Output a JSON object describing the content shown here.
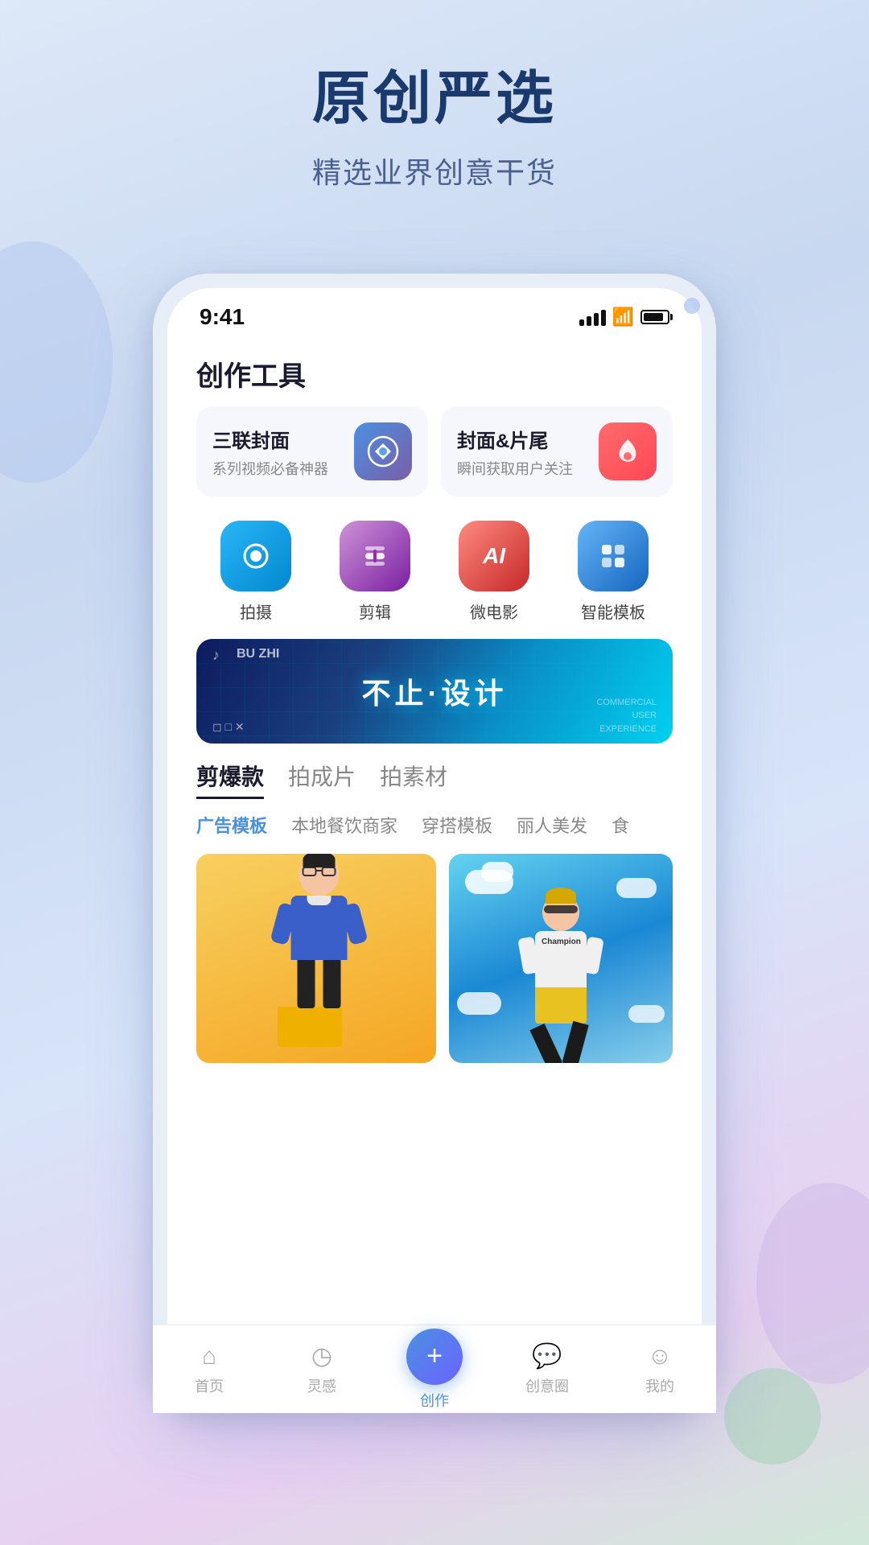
{
  "page": {
    "background": "light blue gradient"
  },
  "hero": {
    "title": "原创严选",
    "subtitle": "精选业界创意干货"
  },
  "phone": {
    "status_bar": {
      "time": "9:41",
      "signal_bars": 4,
      "wifi": true,
      "battery": 85
    },
    "page_title": "创作工具",
    "tool_cards": [
      {
        "id": "triple-cover",
        "title": "三联封面",
        "desc": "系列视频必备神器",
        "icon_type": "blue",
        "icon_symbol": "⭐"
      },
      {
        "id": "cover-tail",
        "title": "封面&片尾",
        "desc": "瞬间获取用户关注",
        "icon_type": "red",
        "icon_symbol": "🔥"
      }
    ],
    "icon_grid": [
      {
        "id": "shoot",
        "label": "拍摄",
        "color": "#4fc3f7",
        "bg": "linear-gradient(135deg, #29b6f6, #0288d1)",
        "symbol": "📷"
      },
      {
        "id": "edit",
        "label": "剪辑",
        "color": "#ab47bc",
        "bg": "linear-gradient(135deg, #ce93d8, #7b1fa2)",
        "symbol": "✂️"
      },
      {
        "id": "micro-film",
        "label": "微电影",
        "color": "#ef5350",
        "bg": "linear-gradient(135deg, #ef9a9a, #c62828)",
        "symbol": "AI"
      },
      {
        "id": "smart-template",
        "label": "智能模板",
        "color": "#42a5f5",
        "bg": "linear-gradient(135deg, #64b5f6, #1565c0)",
        "symbol": "▣"
      }
    ],
    "banner": {
      "main_text": "不止·设计",
      "sub_left": "◻️ □ X",
      "sub_right": "COMMERCIAL\nUSER\nEXPERIENCE",
      "tiktok_logo": "♪",
      "label_buzhi": "BU ZHI"
    },
    "main_tabs": [
      {
        "id": "cut",
        "label": "剪爆款",
        "active": true
      },
      {
        "id": "shoot",
        "label": "拍成片",
        "active": false
      },
      {
        "id": "material",
        "label": "拍素材",
        "active": false
      }
    ],
    "sub_tabs": [
      {
        "id": "ad",
        "label": "广告模板",
        "active": true
      },
      {
        "id": "food",
        "label": "本地餐饮商家",
        "active": false
      },
      {
        "id": "fashion",
        "label": "穿搭模板",
        "active": false
      },
      {
        "id": "beauty",
        "label": "丽人美发",
        "active": false
      },
      {
        "id": "more",
        "label": "食",
        "active": false
      }
    ],
    "image_cards": [
      {
        "id": "yellow-card",
        "bg": "yellow",
        "person_emoji": "🧑‍🎓",
        "theme": "casual blue sweater person sitting"
      },
      {
        "id": "blue-card",
        "bg": "blue",
        "person_emoji": "🧍",
        "theme": "person jumping clouds champion"
      }
    ],
    "bottom_nav": [
      {
        "id": "home",
        "label": "首页",
        "icon": "⌂",
        "active": false
      },
      {
        "id": "inspire",
        "label": "灵感",
        "icon": "◷",
        "active": false
      },
      {
        "id": "create",
        "label": "创作",
        "icon": "+",
        "active": true,
        "center": true
      },
      {
        "id": "circle",
        "label": "创意圈",
        "icon": "💬",
        "active": false
      },
      {
        "id": "mine",
        "label": "我的",
        "icon": "☺",
        "active": false
      }
    ]
  }
}
